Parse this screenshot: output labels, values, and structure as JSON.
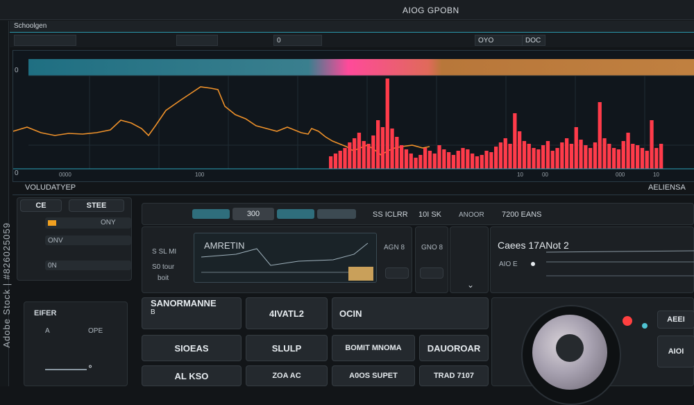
{
  "titlebar": {
    "title": "AIOG GPOBN"
  },
  "strip": {
    "label": "Schoolgen"
  },
  "toolbar": {
    "seg_a": "0",
    "seg_b": "OYO",
    "seg_c": "DOC"
  },
  "graph": {
    "bottom_ticks": [
      "0000",
      "100",
      "10",
      "00",
      "000",
      "10"
    ],
    "left_marks": [
      "0",
      "0"
    ]
  },
  "section": {
    "left_title": "VOLUDATYEP",
    "right_title": "AELIENSA"
  },
  "left_panel": {
    "tab1": "CE",
    "tab2": "STEE",
    "row1": "ONY",
    "row2": "ONV",
    "row3": "0N"
  },
  "mid_header": {
    "field": "300",
    "cell1": "SS ICLRR",
    "cell2": "10I SK",
    "cell3": "ANOOR",
    "cell4": "7200 EANS"
  },
  "mid_panel": {
    "left1": "S SL MI",
    "left2": "S0 tour",
    "left3": "boit",
    "screen_title": "AMRETIN",
    "screen_left": "AGN 8",
    "screen_right": "GNO 8"
  },
  "right_panel": {
    "title": "Caees 17ANot 2",
    "sub": "AIO E"
  },
  "small_panel": {
    "title": "EIFER",
    "row1": "OPE",
    "row2": "A"
  },
  "buttons": {
    "b1": "SANORMANNE",
    "b1_sub": "B",
    "b2": "4IVATL2",
    "b3": "OCIN",
    "b4": "SIOEAS",
    "b5": "SLULP",
    "b6": "BOMIT MNOMA",
    "b7": "DAUOROAR",
    "b8": "AL KSO",
    "b9": "ZOA AC",
    "b10": "A0OS SUPET",
    "b11": "TRAD 7107"
  },
  "knob": {
    "side1": "AEEI",
    "side2": "AIOI"
  },
  "watermark": "Adobe Stock | #826025059",
  "colors": {
    "accent": "#2aa3b8",
    "orange": "#f08a24",
    "red": "#ff3b4a",
    "pink": "#ff4aa0"
  }
}
